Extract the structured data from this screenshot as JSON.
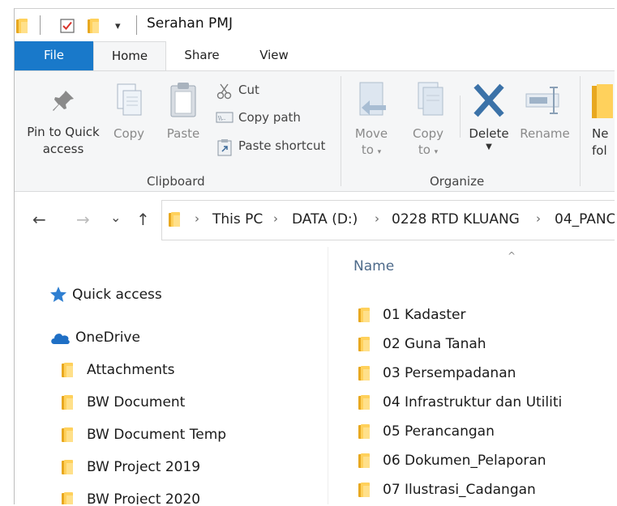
{
  "window": {
    "title": "Serahan PMJ",
    "qat_dropdown": "▾"
  },
  "tabs": {
    "file": "File",
    "home": "Home",
    "share": "Share",
    "view": "View"
  },
  "ribbon": {
    "clipboard": {
      "group_label": "Clipboard",
      "pin_line1": "Pin to Quick",
      "pin_line2": "access",
      "copy": "Copy",
      "paste": "Paste",
      "cut": "Cut",
      "copy_path": "Copy path",
      "paste_shortcut": "Paste shortcut"
    },
    "organize": {
      "group_label": "Organize",
      "move_line1": "Move",
      "move_line2": "to",
      "copy_line1": "Copy",
      "copy_line2": "to",
      "delete": "Delete",
      "rename": "Rename"
    },
    "new": {
      "new_line1": "Ne",
      "new_line2": "fol"
    }
  },
  "address": {
    "back": "←",
    "forward": "→",
    "recent": "⌄",
    "up": "↑",
    "crumbs": [
      "This PC",
      "DATA (D:)",
      "0228 RTD KLUANG",
      "04_PANC"
    ]
  },
  "navpane": {
    "quick_access": "Quick access",
    "onedrive": "OneDrive",
    "folders": [
      "Attachments",
      "BW Document",
      "BW Document Temp",
      "BW Project 2019",
      "BW Project 2020"
    ]
  },
  "filelist": {
    "column_name": "Name",
    "sort_indicator": "^",
    "items": [
      "01 Kadaster",
      "02 Guna Tanah",
      "03 Persempadanan",
      "04 Infrastruktur dan Utiliti",
      "05 Perancangan",
      "06 Dokumen_Pelaporan",
      "07 Ilustrasi_Cadangan"
    ]
  },
  "colors": {
    "file_tab": "#1979ca",
    "ribbon_bg": "#f5f6f7",
    "folder_yellow": "#ffd15c",
    "delete_blue": "#3b72a8"
  }
}
